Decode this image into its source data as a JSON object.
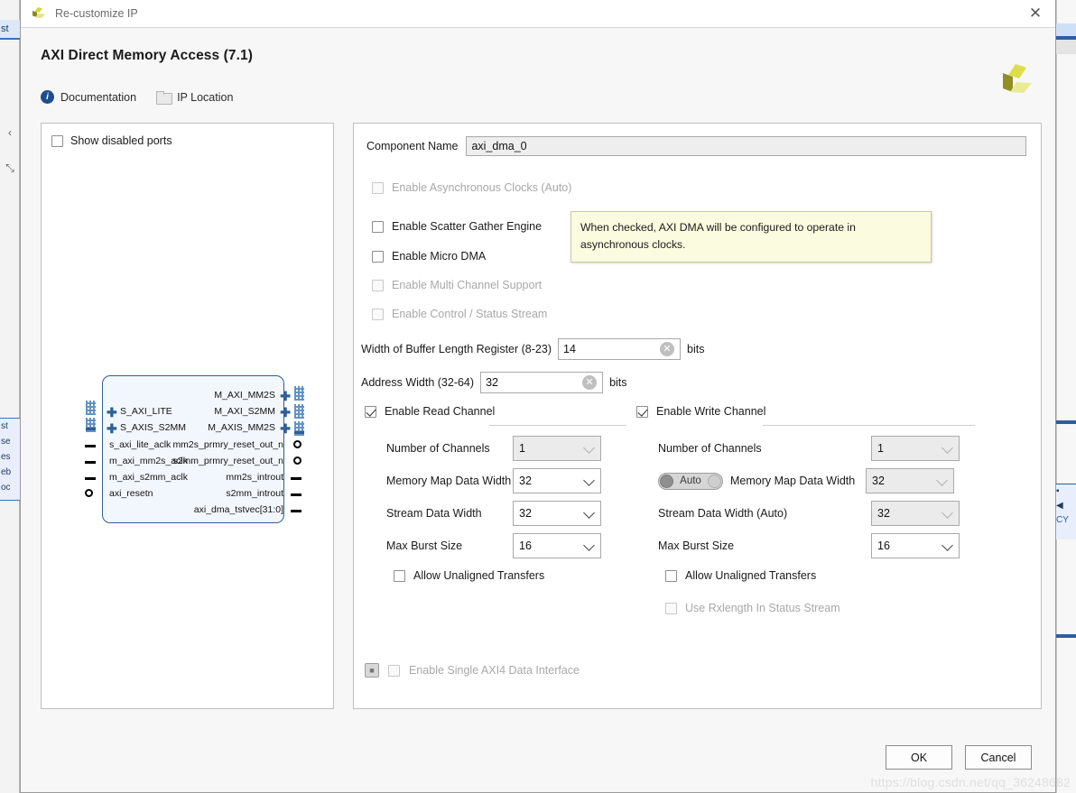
{
  "window": {
    "title": "Re-customize IP",
    "close_icon": "close-icon",
    "logo_icon": "xilinx-logo-icon"
  },
  "header": {
    "ip_title": "AXI Direct Memory Access (7.1)",
    "links": [
      {
        "label": "Documentation",
        "icon": "info-icon"
      },
      {
        "label": "IP Location",
        "icon": "folder-icon"
      }
    ]
  },
  "left_pane": {
    "show_disabled_ports": {
      "label": "Show disabled ports",
      "checked": false
    },
    "diagram": {
      "left_bus_ports": [
        "S_AXI_LITE",
        "S_AXIS_S2MM"
      ],
      "left_pin_ports": [
        "s_axi_lite_aclk",
        "m_axi_mm2s_aclk",
        "m_axi_s2mm_aclk",
        "axi_resetn"
      ],
      "right_bus_ports": [
        "M_AXI_MM2S",
        "M_AXI_S2MM",
        "M_AXIS_MM2S"
      ],
      "right_pin_ports": [
        "mm2s_prmry_reset_out_n",
        "s2mm_prmry_reset_out_n",
        "mm2s_introut",
        "s2mm_introut",
        "axi_dma_tstvec[31:0]"
      ]
    }
  },
  "form": {
    "component_name_label": "Component Name",
    "component_name_value": "axi_dma_0",
    "checkboxes": [
      {
        "label": "Enable Asynchronous Clocks (Auto)",
        "checked": false,
        "disabled": true
      },
      {
        "label": "Enable Scatter Gather Engine",
        "checked": false,
        "disabled": false
      },
      {
        "label": "Enable Micro DMA",
        "checked": false,
        "disabled": false
      },
      {
        "label": "Enable Multi Channel Support",
        "checked": false,
        "disabled": true
      },
      {
        "label": "Enable Control / Status Stream",
        "checked": false,
        "disabled": true
      }
    ],
    "buffer_length": {
      "label": "Width of Buffer Length Register (8-23)",
      "value": "14",
      "unit": "bits",
      "clear_icon": "clear-circle-icon"
    },
    "address_width": {
      "label": "Address Width (32-64)",
      "value": "32",
      "unit": "bits",
      "clear_icon": "clear-circle-icon"
    },
    "tooltip": "When checked, AXI DMA will be configured to operate in asynchronous clocks.",
    "single_axi": {
      "label": "Enable Single AXI4 Data Interface",
      "checked": false,
      "disabled": true
    }
  },
  "read_channel": {
    "title": "Enable Read Channel",
    "checked": true,
    "rows": [
      {
        "label": "Number of Channels",
        "value": "1",
        "gray": true
      },
      {
        "label": "Memory Map Data Width",
        "value": "32",
        "gray": false
      },
      {
        "label": "Stream Data Width",
        "value": "32",
        "gray": false
      },
      {
        "label": "Max Burst Size",
        "value": "16",
        "gray": false
      }
    ],
    "allow_unaligned": {
      "label": "Allow Unaligned Transfers",
      "checked": false
    }
  },
  "write_channel": {
    "title": "Enable Write Channel",
    "checked": true,
    "rows": [
      {
        "label": "Number of Channels",
        "value": "1",
        "gray": true
      },
      {
        "label": "Memory Map Data Width",
        "value": "32",
        "gray": true
      },
      {
        "label": "Stream Data Width (Auto)",
        "value": "32",
        "gray": true
      },
      {
        "label": "Max Burst Size",
        "value": "16",
        "gray": false
      }
    ],
    "auto_toggle": "Auto",
    "allow_unaligned": {
      "label": "Allow Unaligned Transfers",
      "checked": false
    },
    "use_rxlength": {
      "label": "Use Rxlength In Status Stream",
      "checked": false,
      "disabled": true
    }
  },
  "footer": {
    "ok_label": "OK",
    "cancel_label": "Cancel"
  },
  "watermark": "https://blog.csdn.net/qq_36248682",
  "background": {
    "left_tab": "st",
    "left_icons": [
      "‹",
      "⤡"
    ],
    "left_lines": [
      "st",
      "se",
      "es",
      "eb",
      "oc"
    ],
    "right_lines": [
      "■",
      "◀",
      "CY"
    ]
  }
}
